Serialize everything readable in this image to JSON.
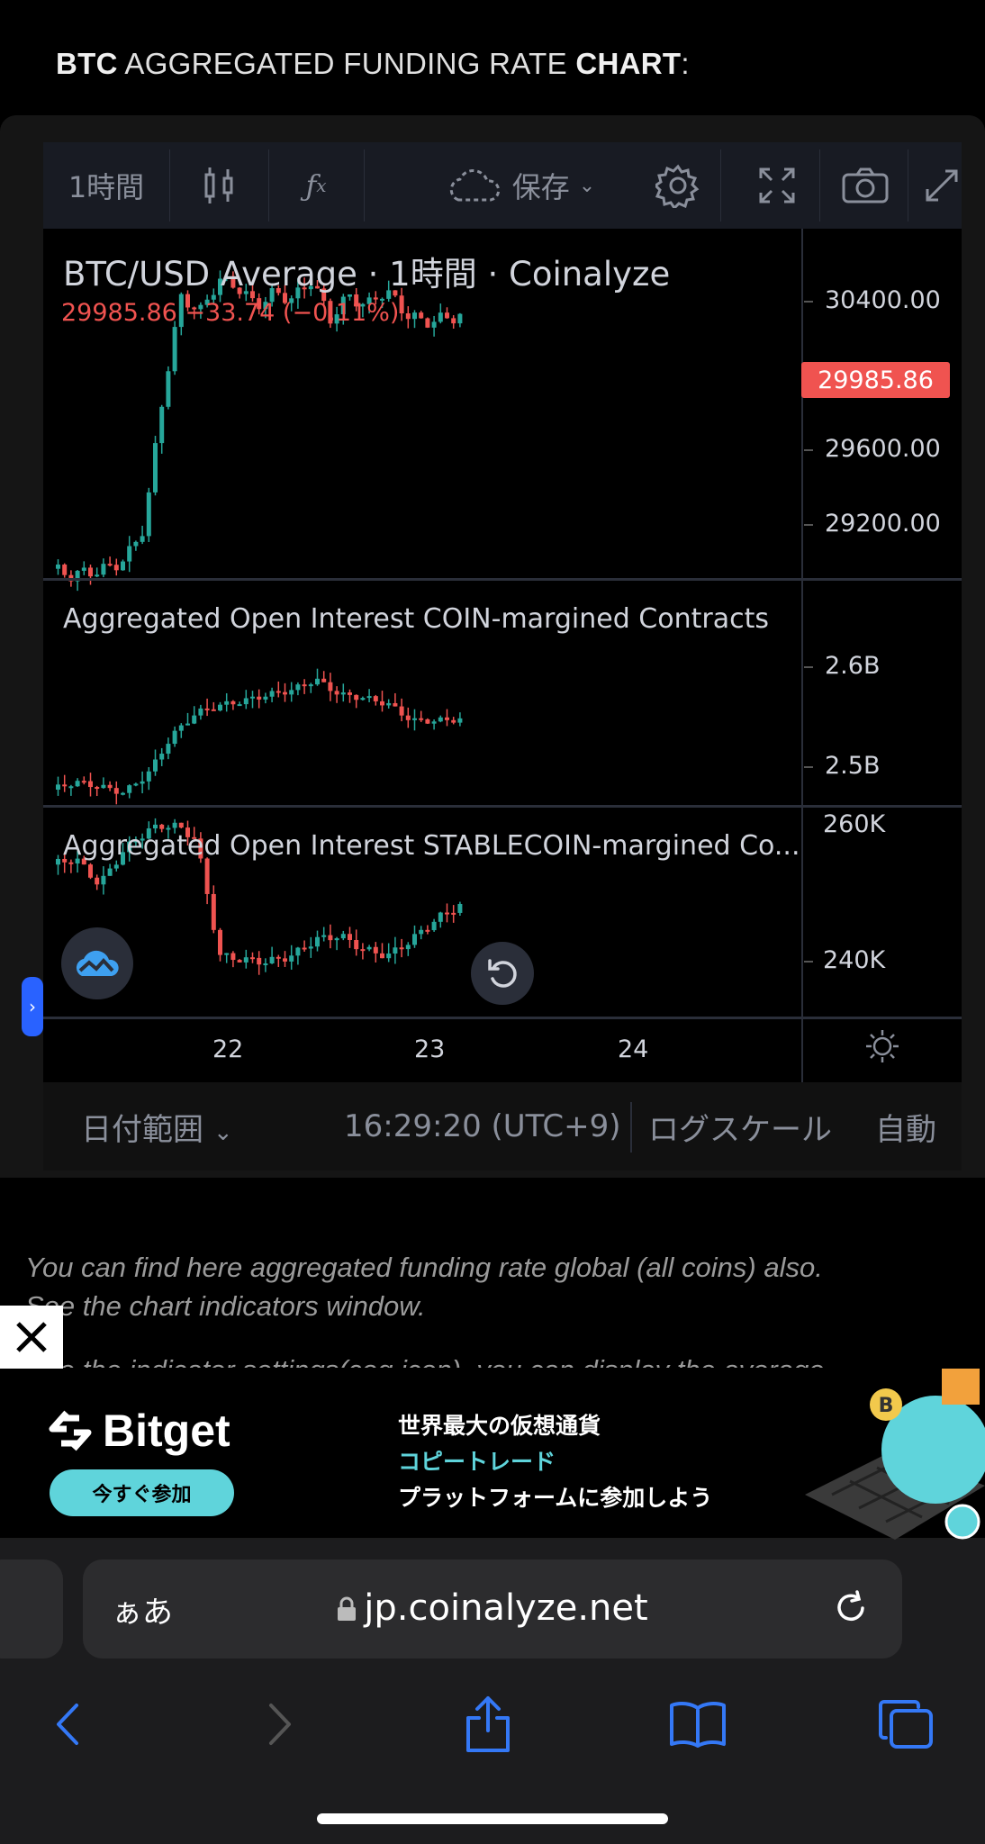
{
  "heading": {
    "bold1": "BTC",
    "middle": " AGGREGATED FUNDING RATE ",
    "bold2": "CHART",
    "tail": ":"
  },
  "toolbar": {
    "interval": "1時間",
    "save_label": "保存"
  },
  "chart": {
    "main_title": "BTC/USD Average · 1時間 · Coinalyze",
    "price_line": "29985.86 −33.74 (−0.11%)",
    "last_price": "29985.86",
    "price_ticks": [
      "30400.00",
      "29600.00",
      "29200.00"
    ],
    "pane2_title": "Aggregated Open Interest COIN-margined Contracts",
    "pane2_ticks": [
      "2.6B",
      "2.5B"
    ],
    "pane3_title": "Aggregated Open Interest STABLECOIN-margined Co...",
    "pane3_ticks": [
      "260K",
      "240K"
    ],
    "x_ticks": [
      "22",
      "23",
      "24"
    ],
    "colors": {
      "up": "#26a69a",
      "down": "#ef5350"
    }
  },
  "chart_data": {
    "type": "candlestick",
    "panes": [
      {
        "name": "BTC/USD Average · 1時間 · Coinalyze",
        "ylim": [
          29100,
          30600
        ],
        "close_last": 29985.86
      },
      {
        "name": "Aggregated Open Interest COIN-margined Contracts",
        "ylim": [
          2.48,
          2.64
        ]
      },
      {
        "name": "Aggregated Open Interest STABLECOIN-margined Co...",
        "ylim": [
          235,
          262
        ]
      }
    ],
    "x_ticks": [
      "22",
      "23",
      "24"
    ]
  },
  "bottom_toolbar": {
    "date_range": "日付範囲",
    "time": "16:29:20 (UTC+9)",
    "log_scale": "ログスケール",
    "auto": "自動"
  },
  "description": {
    "line1": "You can find here aggregated funding rate global (all coins) also.",
    "line2": "See the chart indicators window.",
    "line3": "Use the indicator settings(cog icon), you can display the average"
  },
  "ad": {
    "brand": "Bitget",
    "cta": "今すぐ参加",
    "line1": "世界最大の仮想通貨",
    "line2": "コピートレード",
    "line3": "プラットフォームに参加しよう"
  },
  "browser": {
    "aa": "ぁあ",
    "url": "jp.coinalyze.net"
  }
}
